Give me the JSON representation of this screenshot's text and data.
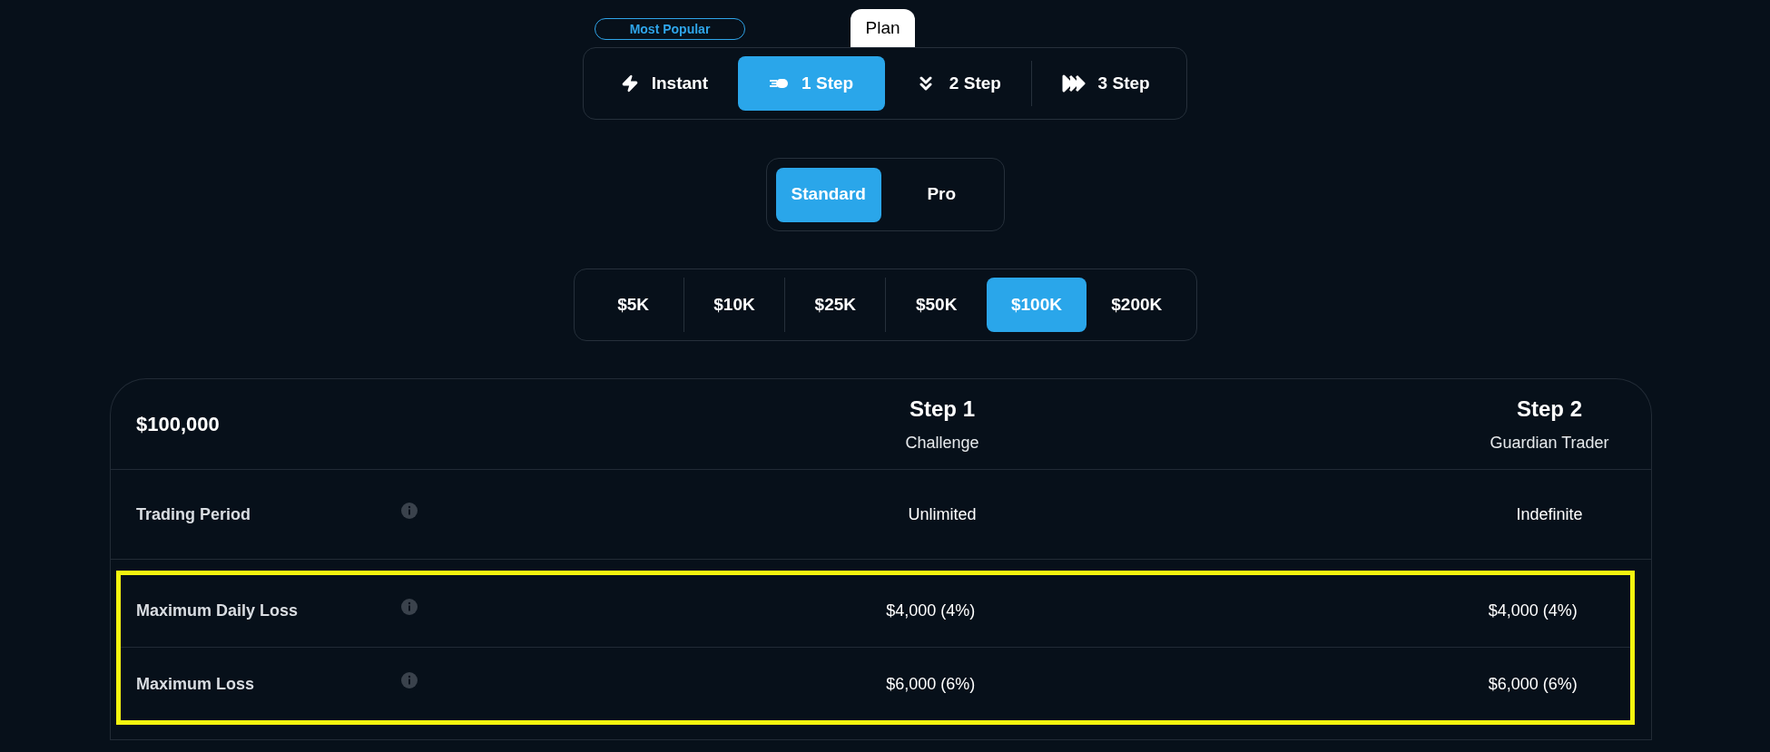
{
  "badge": "Most Popular",
  "plan_label": "Plan",
  "plan_tabs": [
    {
      "label": "Instant",
      "kind": "bolt",
      "selected": false
    },
    {
      "label": "1 Step",
      "kind": "rocket",
      "selected": true
    },
    {
      "label": "2 Step",
      "kind": "chevrons-down",
      "selected": false
    },
    {
      "label": "3 Step",
      "kind": "chevrons-right",
      "selected": false
    }
  ],
  "type_tabs": [
    {
      "label": "Standard",
      "selected": true
    },
    {
      "label": "Pro",
      "selected": false
    }
  ],
  "amount_tabs": [
    {
      "label": "$5K",
      "selected": false
    },
    {
      "label": "$10K",
      "selected": false
    },
    {
      "label": "$25K",
      "selected": false
    },
    {
      "label": "$50K",
      "selected": false
    },
    {
      "label": "$100K",
      "selected": true
    },
    {
      "label": "$200K",
      "selected": false
    }
  ],
  "table": {
    "title": "$100,000",
    "columns": [
      {
        "title": "Step 1",
        "subtitle": "Challenge"
      },
      {
        "title": "Step 2",
        "subtitle": "Guardian Trader"
      }
    ],
    "rows": [
      {
        "label": "Trading Period",
        "values": [
          "Unlimited",
          "Indefinite"
        ],
        "highlighted": false
      },
      {
        "label": "Maximum Daily Loss",
        "values": [
          "$4,000 (4%)",
          "$4,000 (4%)"
        ],
        "highlighted": true
      },
      {
        "label": "Maximum Loss",
        "values": [
          "$6,000 (6%)",
          "$6,000 (6%)"
        ],
        "highlighted": true
      }
    ]
  }
}
